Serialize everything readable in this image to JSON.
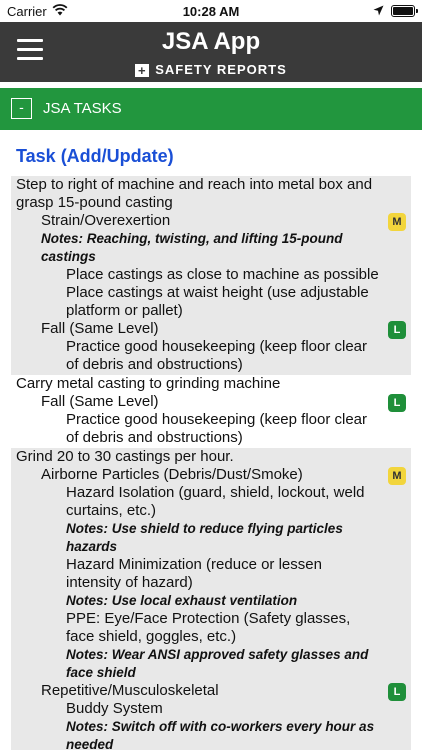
{
  "status_bar": {
    "carrier": "Carrier",
    "time": "10:28 AM"
  },
  "header": {
    "title": "JSA App",
    "subtitle": "SAFETY REPORTS",
    "plus_symbol": "+"
  },
  "section": {
    "toggle": "-",
    "label": "JSA TASKS"
  },
  "page_title": "Task (Add/Update)",
  "tasks": [
    {
      "step": "Step to right of machine and reach into metal box and grasp 15-pound casting",
      "hazards": [
        {
          "name": "Strain/Overexertion",
          "risk": "M",
          "notes": "Notes: Reaching, twisting, and lifting 15-pound castings",
          "controls": [
            {
              "text": "Place castings as close to machine as possible"
            },
            {
              "text": "Place castings at waist height (use adjustable platform or pallet)"
            }
          ]
        },
        {
          "name": "Fall (Same Level)",
          "risk": "L",
          "controls": [
            {
              "text": "Practice good housekeeping (keep floor clear of debris and obstructions)"
            }
          ]
        }
      ]
    },
    {
      "step": "Carry metal casting to grinding machine",
      "hazards": [
        {
          "name": "Fall (Same Level)",
          "risk": "L",
          "controls": [
            {
              "text": "Practice good housekeeping (keep floor clear of debris and obstructions)"
            }
          ]
        }
      ]
    },
    {
      "step": "Grind 20 to 30 castings per hour.",
      "hazards": [
        {
          "name": "Airborne Particles (Debris/Dust/Smoke)",
          "risk": "M",
          "controls": [
            {
              "text": "Hazard Isolation (guard, shield, lockout, weld curtains, etc.)",
              "notes": "Notes: Use shield to reduce flying particles hazards"
            },
            {
              "text": "Hazard Minimization (reduce or lessen intensity of hazard)",
              "notes": "Notes: Use local exhaust ventilation"
            },
            {
              "text": "PPE: Eye/Face Protection (Safety glasses, face shield, goggles, etc.)",
              "notes": "Notes: Wear ANSI approved safety glasses and face shield"
            }
          ]
        },
        {
          "name": "Repetitive/Musculoskeletal",
          "risk": "L",
          "controls": [
            {
              "text": "Buddy System",
              "notes": "Notes: Switch off with co-workers every hour as needed"
            }
          ]
        }
      ]
    }
  ],
  "colors": {
    "header_bg": "#3a3a3a",
    "band_bg": "#22963e",
    "title_blue": "#1a4fd6",
    "shade": "#e8e8e8",
    "badge_medium": "#f2d53c",
    "badge_low": "#1f8f3a"
  },
  "icons": [
    "wifi-icon",
    "location-arrow-icon",
    "battery-icon",
    "hamburger-menu-icon",
    "plus-icon",
    "collapse-icon"
  ]
}
